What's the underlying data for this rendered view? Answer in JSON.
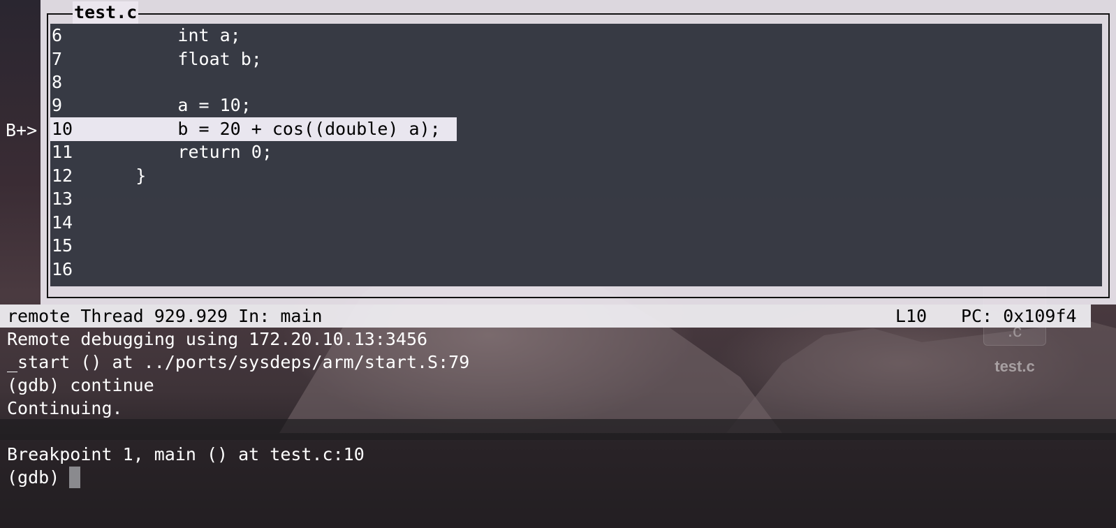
{
  "source_window": {
    "title": "test.c",
    "breakpoint_marker": "B+>",
    "lines": [
      {
        "number": "6",
        "code": "        int a;",
        "current": false
      },
      {
        "number": "7",
        "code": "        float b;",
        "current": false
      },
      {
        "number": "8",
        "code": "",
        "current": false
      },
      {
        "number": "9",
        "code": "        a = 10;",
        "current": false
      },
      {
        "number": "10",
        "code": "        b = 20 + cos((double) a);",
        "current": true
      },
      {
        "number": "11",
        "code": "        return 0;",
        "current": false
      },
      {
        "number": "12",
        "code": "    }",
        "current": false
      },
      {
        "number": "13",
        "code": "",
        "current": false
      },
      {
        "number": "14",
        "code": "",
        "current": false
      },
      {
        "number": "15",
        "code": "",
        "current": false
      },
      {
        "number": "16",
        "code": "",
        "current": false
      }
    ]
  },
  "status_bar": {
    "thread_info": "remote Thread 929.929 In: main",
    "line": "L10",
    "pc": "PC: 0x109f4"
  },
  "console": {
    "lines": [
      "Remote debugging using 172.20.10.13:3456",
      "_start () at ../ports/sysdeps/arm/start.S:79",
      "(gdb) continue",
      "Continuing.",
      "",
      "Breakpoint 1, main () at test.c:10"
    ],
    "prompt": "(gdb)"
  },
  "desktop": {
    "file_icon_label": "test.c",
    "file_icon_ext": ".c"
  }
}
